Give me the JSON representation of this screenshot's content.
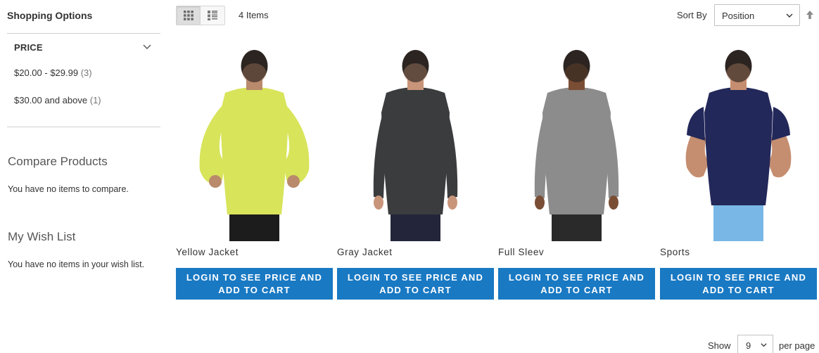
{
  "sidebar": {
    "title": "Shopping Options",
    "filter": {
      "label": "PRICE",
      "options": [
        {
          "range": "$20.00 - $29.99",
          "count": "(3)"
        },
        {
          "range": "$30.00 and above",
          "count": "(1)"
        }
      ]
    },
    "compare": {
      "title": "Compare Products",
      "text": "You have no items to compare."
    },
    "wishlist": {
      "title": "My Wish List",
      "text": "You have no items in your wish list."
    }
  },
  "toolbar": {
    "view_modes": [
      "grid-icon",
      "list-icon"
    ],
    "amount": "4 Items",
    "sort_label": "Sort By",
    "sort_value": "Position",
    "sort_direction_icon": "arrow-up-icon"
  },
  "products": [
    {
      "name": "Yellow Jacket",
      "button": "LOGIN TO SEE PRICE AND ADD TO CART",
      "shirt_color": "#d8e45a",
      "skin": "#b98a6c",
      "pants": "#1c1c1c"
    },
    {
      "name": "Gray Jacket",
      "button": "LOGIN TO SEE PRICE AND ADD TO CART",
      "shirt_color": "#3a3c3e",
      "skin": "#c9957a",
      "pants": "#23253a"
    },
    {
      "name": "Full Sleev",
      "button": "LOGIN TO SEE PRICE AND ADD TO CART",
      "shirt_color": "#8c8c8c",
      "skin": "#7a4e35",
      "pants": "#2a2a2a"
    },
    {
      "name": "Sports",
      "button": "LOGIN TO SEE PRICE AND ADD TO CART",
      "shirt_color": "#23285a",
      "skin": "#c58e70",
      "pants": "#79b8e6"
    }
  ],
  "limiter": {
    "show_label": "Show",
    "value": "9",
    "per_page": "per page"
  },
  "colors": {
    "accent": "#1979c3",
    "divider": "#d1d1d1"
  }
}
